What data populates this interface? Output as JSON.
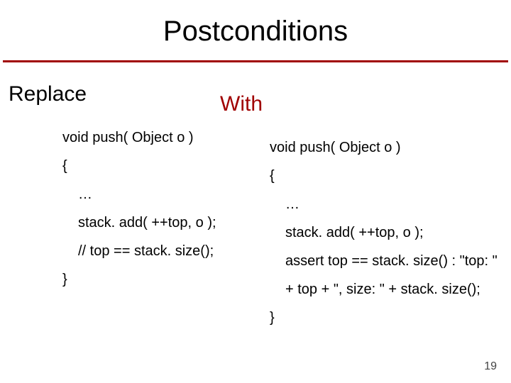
{
  "title": "Postconditions",
  "headings": {
    "replace": "Replace",
    "with": "With"
  },
  "left_code": {
    "l1": "void push( Object o )",
    "l2": "{",
    "l3": "…",
    "l4": "stack. add( ++top, o );",
    "l5": "// top == stack. size();",
    "l6": "}"
  },
  "right_code": {
    "l1": "void push( Object o )",
    "l2": "{",
    "l3": "…",
    "l4": "stack. add( ++top, o );",
    "l5": "assert top == stack. size() : \"top: \"",
    "l6": "+ top + \", size: \" + stack. size();",
    "l7": "}"
  },
  "page_number": "19"
}
